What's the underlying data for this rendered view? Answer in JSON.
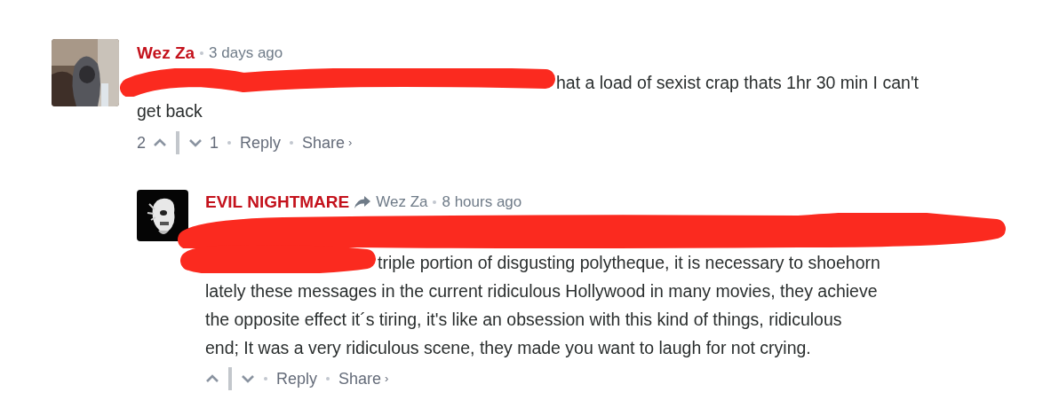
{
  "comments": [
    {
      "author": "Wez Za",
      "time": "3 days ago",
      "redacted": true,
      "lines": [
        "hat a load of sexist crap thats 1hr 30 min I can't",
        "get back"
      ],
      "upvotes": "2",
      "downvotes": "1",
      "reply_label": "Reply",
      "share_label": "Share",
      "share_caret": "›",
      "avatar": {
        "kind": "picture"
      },
      "replies": [
        {
          "author": "EVIL NIGHTMARE",
          "reply_to": "Wez Za",
          "time": "8 hours ago",
          "redacted": true,
          "lines": [
            "triple portion of disgusting polytheque, it is necessary to shoehorn",
            "lately these messages in the current ridiculous Hollywood in many movies, they achieve",
            "the opposite effect it´s tiring, it's like an obsession with this kind of things, ridiculous",
            "end; It was a very ridiculous scene, they made you want to laugh for not crying."
          ],
          "reply_label": "Reply",
          "share_label": "Share",
          "share_caret": "›",
          "avatar": {
            "kind": "picture"
          }
        }
      ]
    }
  ]
}
